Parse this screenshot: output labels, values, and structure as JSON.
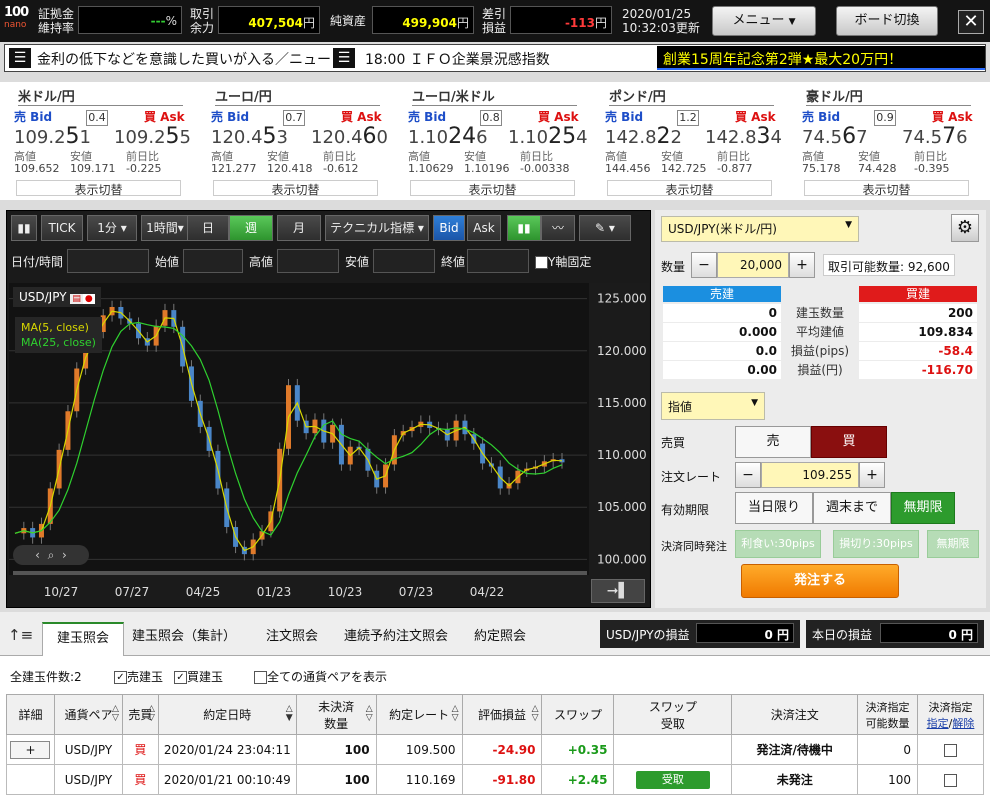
{
  "topbar": {
    "logo_top": "100",
    "logo_bottom": "nano",
    "margin_label_1": "証拠金",
    "margin_label_2": "維持率",
    "margin_value": "---",
    "margin_unit": "%",
    "available_label_1": "取引",
    "available_label_2": "余力",
    "available_value": "407,504",
    "available_unit": "円",
    "net_assets_label": "純資産",
    "net_assets_value": "499,904",
    "net_assets_unit": "円",
    "pl_label_1": "差引",
    "pl_label_2": "損益",
    "pl_value": "-113",
    "pl_unit": "円",
    "date": "2020/01/25",
    "time_updated": "10:32:03更新",
    "menu_label": "メニュー",
    "board_label": "ボード切換",
    "close_label": "✕"
  },
  "news": {
    "headline": "金利の低下などを意識した買いが入る／ニュー",
    "schedule": "18:00 ＩＦＯ企業景況感指数",
    "promo": "創業15周年記念第2弾★最大20万円！"
  },
  "rates": [
    {
      "pair": "米ドル/円",
      "bid_label": "売 Bid",
      "ask_label": "買 Ask",
      "spread": "0.4",
      "bid_pre": "109.2",
      "bid_big": "5",
      "bid_post": "1",
      "ask_pre": "109.2",
      "ask_big": "5",
      "ask_post": "5",
      "high_label": "高値",
      "low_label": "安値",
      "chg_label": "前日比",
      "high": "109.652",
      "low": "109.171",
      "chg": "-0.225",
      "switch": "表示切替"
    },
    {
      "pair": "ユーロ/円",
      "bid_label": "売 Bid",
      "ask_label": "買 Ask",
      "spread": "0.7",
      "bid_pre": "120.4",
      "bid_big": "5",
      "bid_post": "3",
      "ask_pre": "120.4",
      "ask_big": "6",
      "ask_post": "0",
      "high_label": "高値",
      "low_label": "安値",
      "chg_label": "前日比",
      "high": "121.277",
      "low": "120.418",
      "chg": "-0.612",
      "switch": "表示切替"
    },
    {
      "pair": "ユーロ/米ドル",
      "bid_label": "売 Bid",
      "ask_label": "買 Ask",
      "spread": "0.8",
      "bid_pre": "1.10",
      "bid_big": "24",
      "bid_post": "6",
      "ask_pre": "1.10",
      "ask_big": "25",
      "ask_post": "4",
      "high_label": "高値",
      "low_label": "安値",
      "chg_label": "前日比",
      "high": "1.10629",
      "low": "1.10196",
      "chg": "-0.00338",
      "switch": "表示切替"
    },
    {
      "pair": "ポンド/円",
      "bid_label": "売 Bid",
      "ask_label": "買 Ask",
      "spread": "1.2",
      "bid_pre": "142.8",
      "bid_big": "2",
      "bid_post": "2",
      "ask_pre": "142.8",
      "ask_big": "3",
      "ask_post": "4",
      "high_label": "高値",
      "low_label": "安値",
      "chg_label": "前日比",
      "high": "144.456",
      "low": "142.725",
      "chg": "-0.877",
      "switch": "表示切替"
    },
    {
      "pair": "豪ドル/円",
      "bid_label": "売 Bid",
      "ask_label": "買 Ask",
      "spread": "0.9",
      "bid_pre": "74.5",
      "bid_big": "6",
      "bid_post": "7",
      "ask_pre": "74.5",
      "ask_big": "7",
      "ask_post": "6",
      "high_label": "高値",
      "low_label": "安値",
      "chg_label": "前日比",
      "high": "75.178",
      "low": "74.428",
      "chg": "-0.395",
      "switch": "表示切替"
    }
  ],
  "chart_toolbar": {
    "tick": "TICK",
    "interval_1": "1分",
    "interval_2": "1時間",
    "day": "日",
    "week": "週",
    "month": "月",
    "indicator": "テクニカル指標",
    "bid": "Bid",
    "ask": "Ask"
  },
  "chart_filters": {
    "date_label": "日付/時間",
    "open_label": "始値",
    "high_label": "高値",
    "low_label": "安値",
    "close_label": "終値",
    "yfix_label": "Y軸固定"
  },
  "chart_data": {
    "type": "line",
    "symbol": "USD/JPY",
    "legend": [
      {
        "name": "MA(5, close)",
        "color": "#d8d800"
      },
      {
        "name": "MA(25, close)",
        "color": "#2fd12f"
      }
    ],
    "y_ticks": [
      "125.000",
      "120.000",
      "115.000",
      "110.000",
      "105.000",
      "100.000"
    ],
    "ylim": [
      98.5,
      126.5
    ],
    "x_ticks": [
      "10/27",
      "07/27",
      "04/25",
      "01/23",
      "10/23",
      "07/23",
      "04/22"
    ],
    "series": [
      {
        "name": "close",
        "values": [
          102.5,
          103.0,
          102.1,
          103.4,
          106.8,
          110.5,
          114.2,
          118.3,
          120.4,
          121.8,
          123.4,
          124.2,
          123.1,
          122.6,
          121.2,
          120.5,
          122.4,
          123.9,
          122.3,
          118.5,
          115.2,
          112.7,
          110.4,
          106.8,
          103.1,
          101.2,
          100.5,
          101.9,
          102.7,
          104.6,
          110.6,
          116.7,
          113.3,
          112.1,
          113.4,
          111.2,
          112.9,
          109.1,
          110.8,
          110.6,
          108.5,
          106.9,
          109.1,
          111.9,
          112.3,
          112.7,
          113.2,
          112.6,
          112.5,
          111.4,
          113.3,
          112.0,
          111.1,
          109.2,
          108.9,
          106.8,
          107.3,
          108.5,
          108.7,
          108.9,
          109.4,
          109.6,
          109.3
        ]
      }
    ]
  },
  "order_panel": {
    "pair_select": "USD/JPY(米ドル/円)",
    "qty_label": "数量",
    "qty_value": "20,000",
    "tradable_qty": "取引可能数量: 92,600",
    "sell_position": "売建",
    "buy_position": "買建",
    "rows": [
      {
        "label": "建玉数量",
        "sell": "0",
        "buy": "200"
      },
      {
        "label": "平均建値",
        "sell": "0.000",
        "buy": "109.834"
      },
      {
        "label": "損益(pips)",
        "sell": "0.0",
        "buy": "-58.4"
      },
      {
        "label": "損益(円)",
        "sell": "0.00",
        "buy": "-116.70"
      }
    ],
    "order_type": "指値",
    "side_label": "売買",
    "sell_btn": "売",
    "buy_btn": "買",
    "rate_label": "注文レート",
    "rate_value": "109.255",
    "expiry_label": "有効期限",
    "expiry_day": "当日限り",
    "expiry_week": "週末まで",
    "expiry_none": "無期限",
    "settle_label": "決済同時発注",
    "settle_profit": "利食い:30pips",
    "settle_loss": "損切り:30pips",
    "settle_none": "無期限",
    "submit": "発注する"
  },
  "positions": {
    "tabs": [
      "建玉照会",
      "建玉照会（集計）",
      "注文照会",
      "連続予約注文照会",
      "約定照会"
    ],
    "pair_pl_label": "USD/JPYの損益",
    "pair_pl_value": "0 円",
    "today_pl_label": "本日の損益",
    "today_pl_value": "0 円",
    "count_label": "全建玉件数:2",
    "sell_filter": "売建玉",
    "buy_filter": "買建玉",
    "all_pairs": "全ての通貨ペアを表示",
    "headers": [
      "詳細",
      "通貨ペア",
      "売買",
      "約定日時",
      "未決済数量",
      "約定レート",
      "評価損益",
      "スワップ",
      "スワップ受取",
      "決済注文",
      "決済指定可能数量",
      "決済指定"
    ],
    "header_set_1": "決済指定",
    "header_set_2": "指定",
    "header_set_3": "解除",
    "header_qty_1": "未決済",
    "header_qty_2": "数量",
    "header_swap_1": "スワップ",
    "header_swap_2": "受取",
    "header_avail_1": "決済指定",
    "header_avail_2": "可能数量",
    "rows": [
      {
        "detail": "+",
        "pair": "USD/JPY",
        "side": "買",
        "datetime": "2020/01/24 23:04:11",
        "qty": "100",
        "rate": "109.500",
        "pl": "-24.90",
        "swap": "+0.35",
        "receive": "",
        "settle": "発注済/待機中",
        "avail": "0"
      },
      {
        "detail": "",
        "pair": "USD/JPY",
        "side": "買",
        "datetime": "2020/01/21 00:10:49",
        "qty": "100",
        "rate": "110.169",
        "pl": "-91.80",
        "swap": "+2.45",
        "receive": "受取",
        "settle": "未発注",
        "avail": "100"
      }
    ]
  }
}
